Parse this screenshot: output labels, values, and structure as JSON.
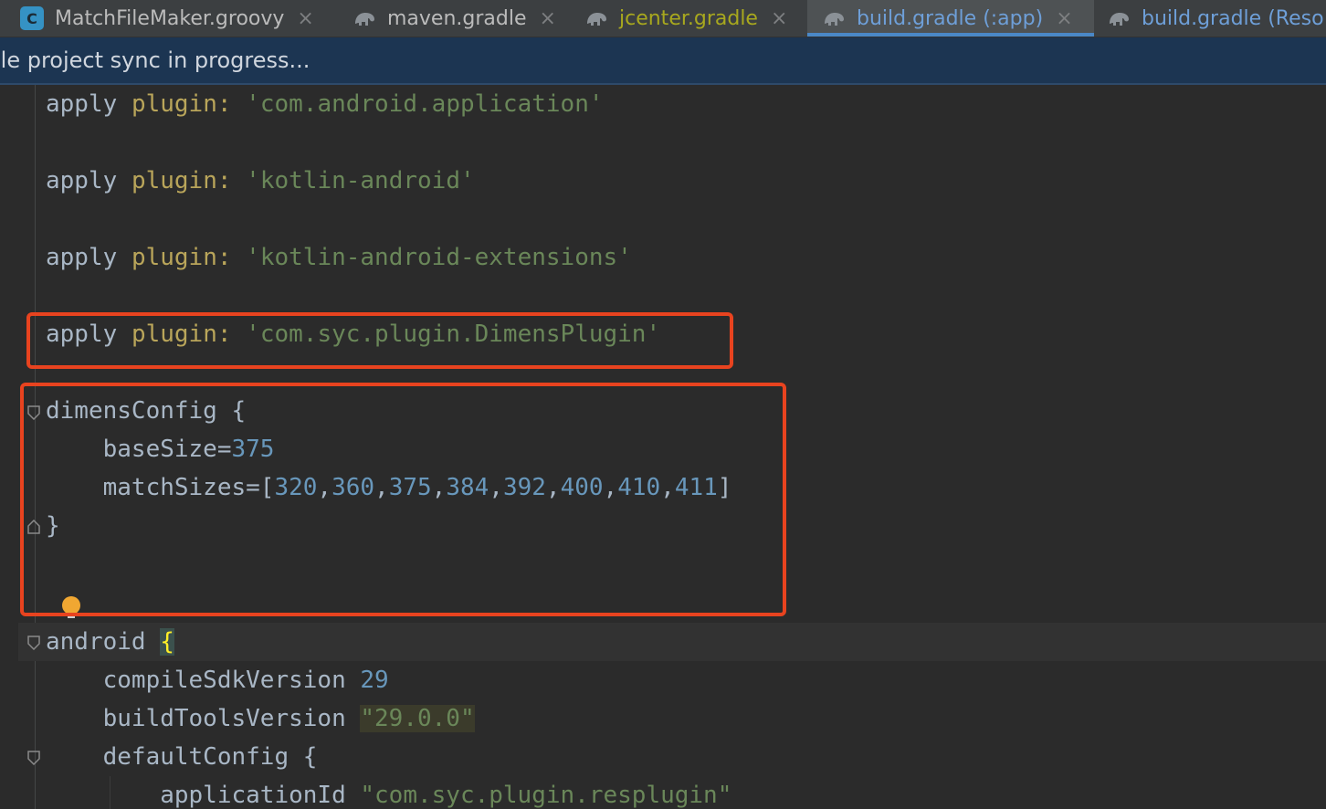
{
  "tabs": [
    {
      "label": "MatchFileMaker.groovy",
      "icon": "groovy-class-icon",
      "icon_letter": "C",
      "close": "×"
    },
    {
      "label": "maven.gradle",
      "icon": "gradle-elephant-icon",
      "close": "×"
    },
    {
      "label": "jcenter.gradle",
      "icon": "gradle-elephant-icon",
      "close": "×"
    },
    {
      "label": "build.gradle (:app)",
      "icon": "gradle-elephant-icon",
      "close": "×"
    },
    {
      "label": "build.gradle (Reso",
      "icon": "gradle-elephant-icon"
    }
  ],
  "banner": {
    "text": "lle project sync in progress..."
  },
  "code": {
    "l1": {
      "kw": "apply",
      "p": "plugin",
      "c": ":",
      "s": "'com.android.application'"
    },
    "l2": {
      "kw": "apply",
      "p": "plugin",
      "c": ":",
      "s": "'kotlin-android'"
    },
    "l3": {
      "kw": "apply",
      "p": "plugin",
      "c": ":",
      "s": "'kotlin-android-extensions'"
    },
    "l4": {
      "kw": "apply",
      "p": "plugin",
      "c": ":",
      "s": "'com.syc.plugin.DimensPlugin'"
    },
    "l5": {
      "text": "dimensConfig {"
    },
    "l6": {
      "name": "    baseSize=",
      "val": "375"
    },
    "l7": {
      "name": "    matchSizes=[",
      "vals": [
        "320",
        "360",
        "375",
        "384",
        "392",
        "400",
        "410",
        "411"
      ],
      "end": "]"
    },
    "l8": {
      "text": "}"
    },
    "l9": {
      "name": "android ",
      "brace": "{"
    },
    "l10": {
      "name": "    compileSdkVersion ",
      "val": "29"
    },
    "l11": {
      "name": "    buildToolsVersion ",
      "val": "\"29.0.0\""
    },
    "l12": {
      "text": "    defaultConfig {"
    },
    "l13": {
      "name": "        applicationId ",
      "val": "\"com.syc.plugin.resplugin\""
    }
  },
  "colors": {
    "highlight_box": "#e8431f",
    "string": "#6a8759",
    "number": "#6897bb",
    "banner": "#1c3552"
  }
}
